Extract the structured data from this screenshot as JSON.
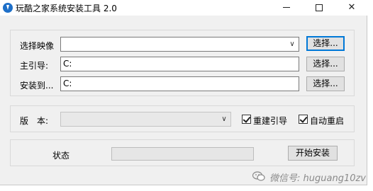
{
  "window": {
    "title": "玩酷之家系统安装工具 2.0",
    "minimize": "minimize",
    "maximize": "maximize",
    "close": "✕"
  },
  "image_group": {
    "select_image_label": "选择映像",
    "select_image_value": "",
    "boot_label": "主引导:",
    "boot_value": "C:",
    "install_label": "安装到...",
    "install_value": "C:",
    "browse_label": "选择..."
  },
  "version_group": {
    "version_label": "版　本:",
    "version_value": "",
    "rebuild_boot_label": "重建引导",
    "rebuild_boot_checked": true,
    "auto_restart_label": "自动重启",
    "auto_restart_checked": true
  },
  "status_group": {
    "status_label": "状态",
    "progress": 0,
    "start_button": "开始安装"
  },
  "watermark": {
    "text": "微信号: huguang10zv"
  }
}
